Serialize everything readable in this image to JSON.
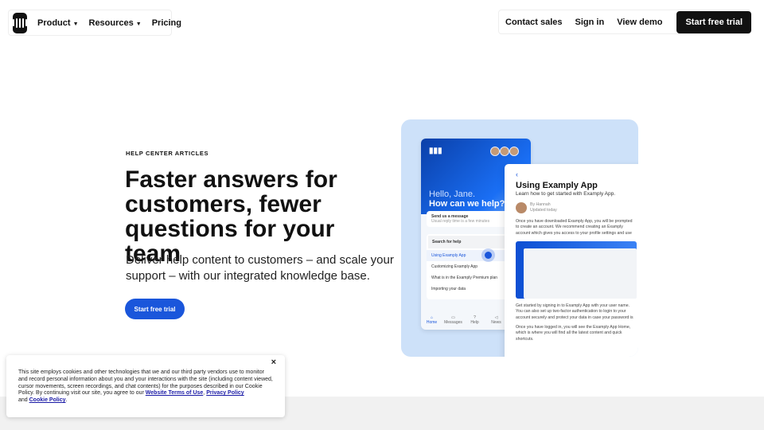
{
  "nav": {
    "product": "Product",
    "resources": "Resources",
    "pricing": "Pricing",
    "contact": "Contact sales",
    "signin": "Sign in",
    "demo": "View demo",
    "trial": "Start free trial"
  },
  "hero": {
    "eyebrow": "HELP CENTER ARTICLES",
    "title": "Faster answers for customers, fewer questions for your team",
    "subtitle": "Deliver help content to customers – and scale your support – with our integrated knowledge base.",
    "cta": "Start free trial"
  },
  "mockup": {
    "greeting": "Hello, Jane.",
    "question": "How can we help?",
    "send_title": "Send us a message",
    "send_sub": "Usual reply time is a few minutes",
    "search": "Search for help",
    "results": [
      "Using Examply App",
      "Customizing Examply App",
      "What is in the Examply Premium plan",
      "Importing your data"
    ],
    "tabs": [
      "Home",
      "Messages",
      "Help",
      "News"
    ],
    "article_title": "Using Examply App",
    "article_sub": "Learn how to get started with Examply App.",
    "author": "By Hannah",
    "updated": "Updated today",
    "p1": "Once you have downloaded Examply App, you will be prompted to create an account. We recommend creating an Examply account which gives you access to your profile settings and use all of Examply features.",
    "p2": "Get started by signing in to Examply App with your user name. You can also set up two-factor authentication to login to your account securely and protect your data in case your password is stolen.",
    "p3": "Once you have logged in, you will see the Examply App Home, which is where you will find all the latest content and quick shortcuts."
  },
  "cookie": {
    "text": "This site employs cookies and other technologies that we and our third party vendors use to monitor and record personal information about you and your interactions with the site (including content viewed, cursor movements, screen recordings, and chat contents) for the purposes described in our Cookie Policy. By continuing visit our site, you agree to our ",
    "terms": "Website Terms of Use",
    "comma": ",",
    "privacy": "Privacy Policy",
    "and": " and ",
    "policy": "Cookie Policy",
    "end": ".",
    "close": "×"
  },
  "colors": {
    "accent": "#1a56db",
    "dark": "#111111"
  }
}
